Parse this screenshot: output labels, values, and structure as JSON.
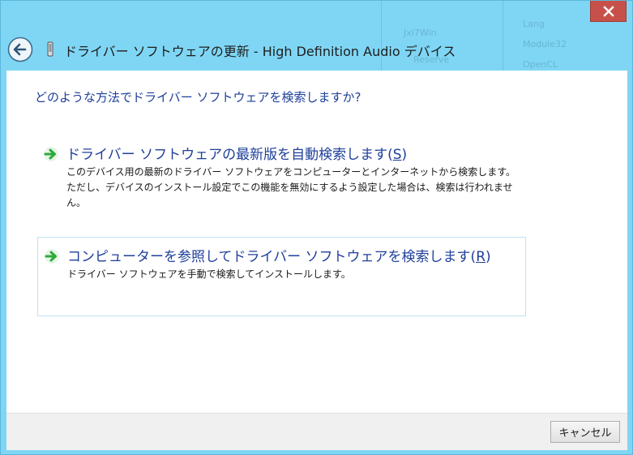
{
  "window": {
    "title": "ドライバー ソフトウェアの更新 - High Definition Audio デバイス",
    "close_symbol": "✕"
  },
  "background_ghost": {
    "items": [
      "Jxl7Win",
      "Lang",
      "Module32",
      "Reserve",
      "OpenCL"
    ]
  },
  "content": {
    "question": "どのような方法でドライバー ソフトウェアを検索しますか?",
    "options": [
      {
        "title_pre": "ドライバー ソフトウェアの最新版を自動検索します(",
        "accesskey": "S",
        "title_post": ")",
        "description": "このデバイス用の最新のドライバー ソフトウェアをコンピューターとインターネットから検索します。ただし、デバイスのインストール設定でこの機能を無効にするよう設定した場合は、検索は行われません。"
      },
      {
        "title_pre": "コンピューターを参照してドライバー ソフトウェアを検索します(",
        "accesskey": "R",
        "title_post": ")",
        "description": "ドライバー ソフトウェアを手動で検索してインストールします。"
      }
    ]
  },
  "footer": {
    "cancel_label": "キャンセル"
  },
  "colors": {
    "glass": "#7fd6f4",
    "link_blue": "#1f3f9a",
    "arrow_green": "#2eaa3a",
    "close_red": "#c7504a"
  },
  "icons": [
    "back-arrow-icon",
    "device-icon",
    "close-icon",
    "green-arrow-icon"
  ]
}
